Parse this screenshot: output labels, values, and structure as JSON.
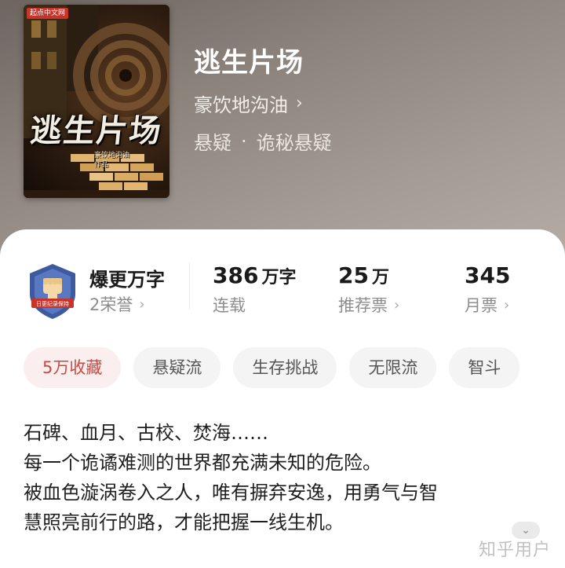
{
  "book": {
    "cover": {
      "title": "逃生片场",
      "publisher_badge": "起点中文网",
      "author_line1": "豪饮地沟油",
      "author_line2": "作品"
    },
    "title": "逃生片场",
    "author": "豪饮地沟油",
    "genre_primary": "悬疑",
    "genre_separator": "·",
    "genre_secondary": "诡秘悬疑"
  },
  "honor": {
    "title": "爆更万字",
    "count_label": "2荣誉",
    "emblem_icon": "fist-shield-icon",
    "emblem_ribbon": "日更纪录保持",
    "colors": {
      "shield": "#3d5a9e",
      "ribbon": "#c8332a"
    }
  },
  "stats": [
    {
      "value": "386",
      "unit": "万字",
      "label": "连载",
      "chevron": false
    },
    {
      "value": "25",
      "unit": "万",
      "label": "推荐票",
      "chevron": true
    },
    {
      "value": "345",
      "unit": "",
      "label": "月票",
      "chevron": true
    }
  ],
  "tags": [
    {
      "label": "5万收藏",
      "accent": true
    },
    {
      "label": "悬疑流",
      "accent": false
    },
    {
      "label": "生存挑战",
      "accent": false
    },
    {
      "label": "无限流",
      "accent": false
    },
    {
      "label": "智斗",
      "accent": false
    }
  ],
  "description": {
    "line1": "石碑、血月、古校、焚海……",
    "line2": "每一个诡谲难测的世界都充满未知的危险。",
    "line3": "被血色漩涡卷入之人，唯有摒弃安逸，用勇气与智",
    "line4": "慧照亮前行的路，才能把握一线生机。"
  },
  "expand_icon": "chevron-down-icon",
  "watermark": "知乎用户",
  "colors": {
    "accent": "#c84a43",
    "accent_bg": "#fbeeee",
    "tag_bg": "#f4f4f4"
  }
}
